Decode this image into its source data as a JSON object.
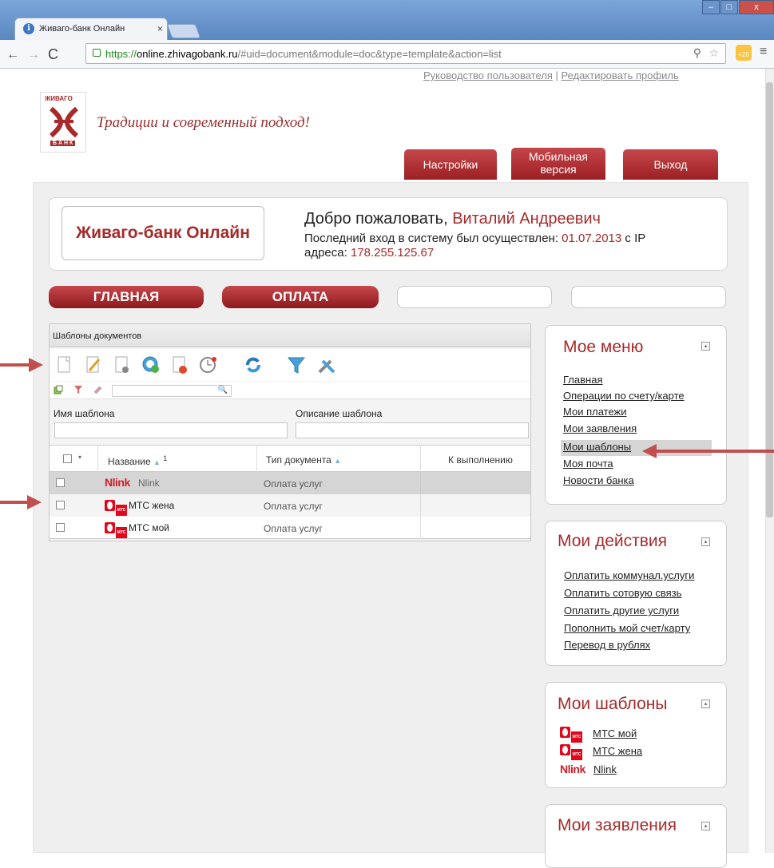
{
  "browser": {
    "tab_title": "Живаго-банк Онлайн",
    "url_scheme": "https://",
    "url_host": "online.zhivagobank.ru",
    "url_path": "/#uid=document&module=doc&type=template&action=list",
    "ext_badge": "+20"
  },
  "header": {
    "link_manual": "Руководство пользователя",
    "link_separator": "|",
    "link_profile": "Редактировать профиль",
    "logo_top": "ЖИВАГО",
    "logo_bottom": "Б А Н К",
    "slogan": "Традиции и современный подход!",
    "btn_settings": "Настройки",
    "btn_mobile_line1": "Мобильная",
    "btn_mobile_line2": "версия",
    "btn_exit": "Выход"
  },
  "welcome": {
    "brand": "Живаго-банк Онлайн",
    "greeting": "Добро пожаловать,",
    "user_name": "Виталий Андреевич",
    "last_login_text": "Последний вход в систему был осуществлен:",
    "last_login_date": "01.07.2013",
    "ip_prefix": "с IP",
    "ip_label": "адреса:",
    "ip": "178.255.125.67"
  },
  "nav": {
    "main": "ГЛАВНАЯ",
    "pay": "ОПЛАТА"
  },
  "grid": {
    "title": "Шаблоны документов",
    "filter_name_label": "Имя шаблона",
    "filter_desc_label": "Описание шаблона",
    "col_name": "Название",
    "col_name_sort": "1",
    "col_type": "Тип документа",
    "col_exec": "К выполнению",
    "rows": [
      {
        "name": "Nlink",
        "logo": "Nlink",
        "type": "Оплата услуг"
      },
      {
        "name": "МТС жена",
        "logo": "МТС",
        "type": "Оплата услуг"
      },
      {
        "name": "МТС мой",
        "logo": "МТС",
        "type": "Оплата услуг"
      }
    ]
  },
  "my_menu": {
    "title": "Мое меню",
    "items": [
      "Главная",
      "Операции по счету/карте",
      "Мои платежи",
      "Мои заявления",
      "Мои шаблоны",
      "Моя почта",
      "Новости банка"
    ],
    "selected": "Мои шаблоны"
  },
  "my_actions": {
    "title": "Мои действия",
    "items": [
      "Оплатить коммунал.услуги",
      "Оплатить сотовую связь",
      "Оплатить другие услуги",
      "Пополнить мой счет/карту",
      "Перевод в рублях"
    ]
  },
  "my_templates": {
    "title": "Мои шаблоны",
    "items": [
      {
        "logo": "МТС",
        "label": "МТС мой"
      },
      {
        "logo": "МТС",
        "label": "МТС жена"
      },
      {
        "logo": "Nlink",
        "label": "Nlink"
      }
    ]
  },
  "my_requests": {
    "title": "Мои заявления"
  },
  "colors": {
    "brand_red": "#a62b2b",
    "annotation_arrow": "#c0504d",
    "mts_red": "#e1061b"
  },
  "icons": [
    "new-doc-icon",
    "edit-doc-icon",
    "doc-settings-icon",
    "schedule-icon",
    "delete-doc-icon",
    "alarm-icon",
    "refresh-icon",
    "filter-icon",
    "tools-icon"
  ]
}
